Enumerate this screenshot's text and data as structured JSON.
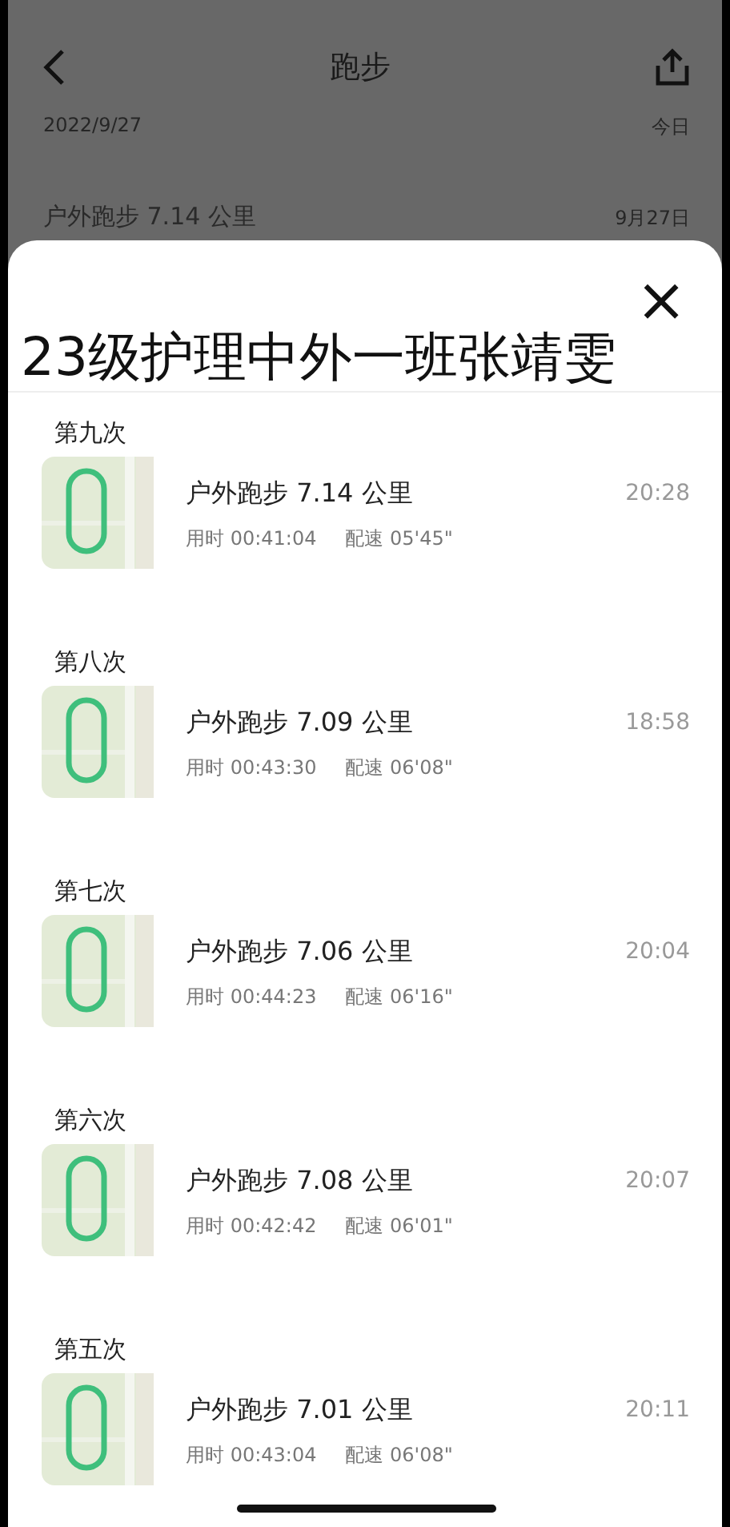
{
  "background": {
    "title": "跑步",
    "date": "2022/9/27",
    "date_tag": "今日",
    "record": "户外跑步 7.14 公里",
    "record_date": "9月27日"
  },
  "sheet": {
    "title": "23级护理中外一班张靖雯",
    "close": "×"
  },
  "runs": [
    {
      "label": "第九次",
      "title": "户外跑步 7.14 公里",
      "duration": "用时 00:41:04",
      "pace": "配速 05'45\"",
      "time": "20:28"
    },
    {
      "label": "第八次",
      "title": "户外跑步 7.09 公里",
      "duration": "用时 00:43:30",
      "pace": "配速 06'08\"",
      "time": "18:58"
    },
    {
      "label": "第七次",
      "title": "户外跑步 7.06 公里",
      "duration": "用时 00:44:23",
      "pace": "配速 06'16\"",
      "time": "20:04"
    },
    {
      "label": "第六次",
      "title": "户外跑步 7.08 公里",
      "duration": "用时 00:42:42",
      "pace": "配速 06'01\"",
      "time": "20:07"
    },
    {
      "label": "第五次",
      "title": "户外跑步 7.01 公里",
      "duration": "用时 00:43:04",
      "pace": "配速 06'08\"",
      "time": "20:11"
    }
  ]
}
